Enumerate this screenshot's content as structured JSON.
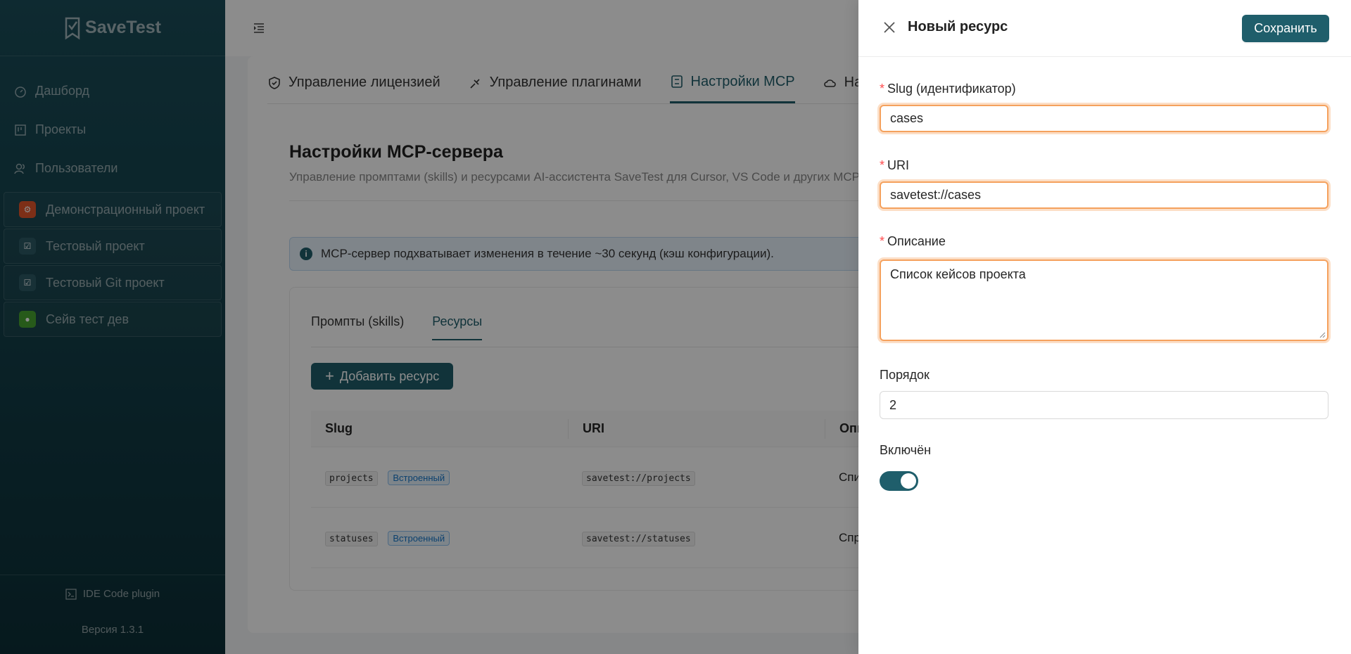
{
  "sidebar": {
    "logo": "SaveTest",
    "nav": [
      {
        "label": "Дашборд",
        "icon": "dashboard-icon"
      },
      {
        "label": "Проекты",
        "icon": "projects-icon"
      },
      {
        "label": "Пользователи",
        "icon": "users-icon"
      }
    ],
    "projects": [
      {
        "label": "Демонстрационный проект",
        "icon": "bug-icon",
        "color": "#e3562b"
      },
      {
        "label": "Тестовый проект",
        "icon": "checklist-icon",
        "color": "#2c5964"
      },
      {
        "label": "Тестовый Git проект",
        "icon": "checklist-icon",
        "color": "#2c5964"
      },
      {
        "label": "Сейв тест дев",
        "icon": "mic-icon",
        "color": "#48a531"
      }
    ],
    "plugin_label": "IDE Code plugin",
    "version": "Версия 1.3.1"
  },
  "main": {
    "tabs": [
      {
        "label": "Управление лицензией",
        "icon": "shield-check-icon"
      },
      {
        "label": "Управление плагинами",
        "icon": "plugin-icon"
      },
      {
        "label": "Настройки MCP",
        "icon": "robot-icon",
        "active": true
      },
      {
        "label": "На",
        "icon": "cloud-icon"
      }
    ],
    "title": "Настройки MCP-сервера",
    "subtitle": "Управление промптами (skills) и ресурсами AI-ассистента SaveTest для Cursor, VS Code и других MCP",
    "alert": "MCP-сервер подхватывает изменения в течение ~30 секунд (кэш конфигурации).",
    "subtabs": [
      {
        "label": "Промпты (skills)"
      },
      {
        "label": "Ресурсы",
        "active": true
      }
    ],
    "add_button": "Добавить ресурс",
    "table": {
      "headers": [
        "Slug",
        "URI",
        "Опи"
      ],
      "rows": [
        {
          "slug": "projects",
          "tag": "Встроенный",
          "uri": "savetest://projects",
          "desc": "Спи"
        },
        {
          "slug": "statuses",
          "tag": "Встроенный",
          "uri": "savetest://statuses",
          "desc": "Спр"
        }
      ]
    }
  },
  "drawer": {
    "title": "Новый ресурс",
    "save_label": "Сохранить",
    "fields": {
      "slug_label": "Slug (идентификатор)",
      "slug_value": "cases",
      "uri_label": "URI",
      "uri_value": "savetest://cases",
      "desc_label": "Описание",
      "desc_value": "Список кейсов проекта",
      "order_label": "Порядок",
      "order_value": "2",
      "enabled_label": "Включён",
      "enabled": true
    },
    "required_mark": "*"
  },
  "colors": {
    "accent": "#1f5e6b",
    "error_outline": "#f5a15d",
    "required": "#ff4d4f"
  }
}
